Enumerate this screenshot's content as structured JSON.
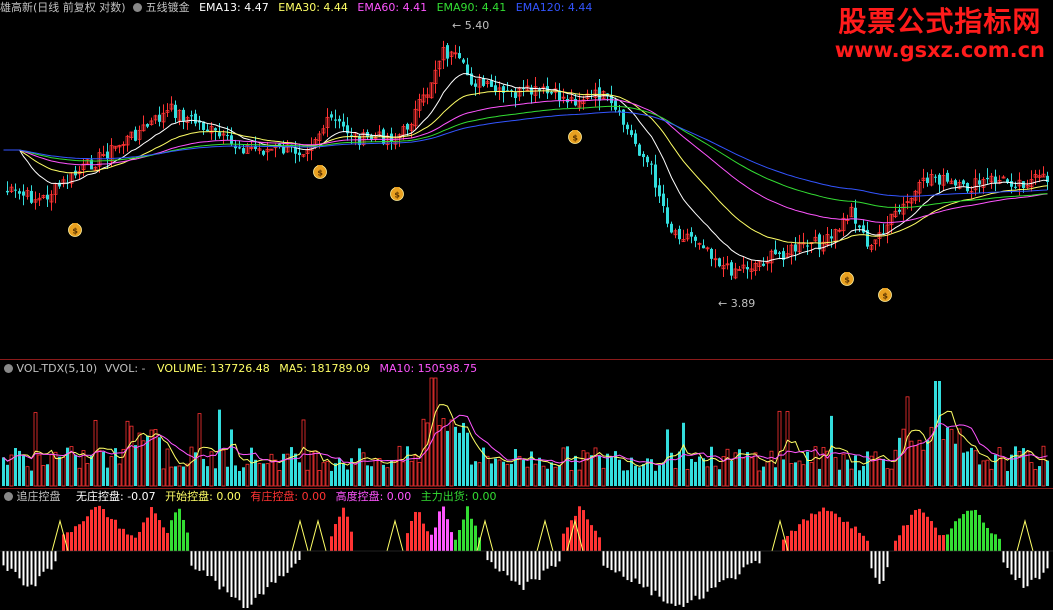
{
  "main_legend": {
    "title": "雄高新(日线 前复权 对数)",
    "indicator": "五线镀金",
    "items": [
      {
        "label": "EMA13: 4.47",
        "color": "#ffffff"
      },
      {
        "label": "EMA30: 4.44",
        "color": "#ffff66"
      },
      {
        "label": "EMA60: 4.41",
        "color": "#ff55ff"
      },
      {
        "label": "EMA90: 4.41",
        "color": "#33dd33"
      },
      {
        "label": "EMA120: 4.44",
        "color": "#3355ff"
      }
    ]
  },
  "price_annotations": {
    "high": "5.40",
    "low": "3.89"
  },
  "watermark": {
    "line1": "股票公式指标网",
    "line2": "www.gsxz.com.cn"
  },
  "volume_legend": {
    "items": [
      {
        "label": "VOL-TDX(5,10)",
        "color": "#c0c0c0"
      },
      {
        "label": "VVOL: -",
        "color": "#c0c0c0"
      },
      {
        "label": "VOLUME: 137726.48",
        "color": "#ffff66"
      },
      {
        "label": "MA5: 181789.09",
        "color": "#ffff66"
      },
      {
        "label": "MA10: 150598.75",
        "color": "#ff55ff"
      }
    ]
  },
  "indicator_legend": {
    "items": [
      {
        "label": "追庄控盘",
        "color": "#c0c0c0"
      },
      {
        "label": "无庄控盘: -0.07",
        "color": "#ffffff"
      },
      {
        "label": "开始控盘: 0.00",
        "color": "#ffff66"
      },
      {
        "label": "有庄控盘: 0.00",
        "color": "#ff3333"
      },
      {
        "label": "高度控盘: 0.00",
        "color": "#ff55ff"
      },
      {
        "label": "主力出货: 0.00",
        "color": "#33dd33"
      }
    ]
  },
  "colors": {
    "up": "#ff3333",
    "down": "#33dddd",
    "bg": "#000000",
    "grid": "#8b1a1a"
  }
}
